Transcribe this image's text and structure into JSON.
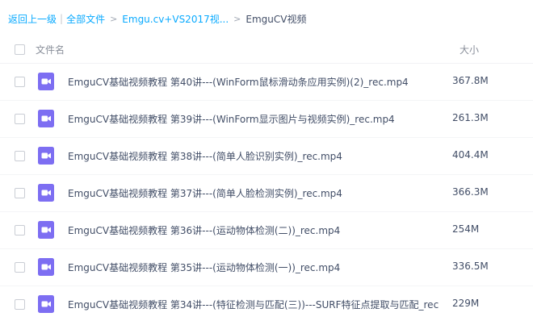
{
  "breadcrumb": {
    "back_label": "返回上一级",
    "sep_bar": "|",
    "all_files_label": "全部文件",
    "chevron": ">",
    "path_item_1": "Emgu.cv+VS2017视...",
    "current": "EmguCV视频"
  },
  "header": {
    "name_label": "文件名",
    "size_label": "大小"
  },
  "file_icon": "video-file-icon",
  "accent_color": "#7d6ef2",
  "files": [
    {
      "name": "EmguCV基础视频教程 第40讲---(WinForm鼠标滑动条应用实例)(2)_rec.mp4",
      "size": "367.8M"
    },
    {
      "name": "EmguCV基础视频教程 第39讲---(WinForm显示图片与视频实例)_rec.mp4",
      "size": "261.3M"
    },
    {
      "name": "EmguCV基础视频教程 第38讲---(简单人脸识别实例)_rec.mp4",
      "size": "404.4M"
    },
    {
      "name": "EmguCV基础视频教程 第37讲---(简单人脸检测实例)_rec.mp4",
      "size": "366.3M"
    },
    {
      "name": "EmguCV基础视频教程 第36讲---(运动物体检测(二))_rec.mp4",
      "size": "254M"
    },
    {
      "name": "EmguCV基础视频教程 第35讲---(运动物体检测(一))_rec.mp4",
      "size": "336.5M"
    },
    {
      "name": "EmguCV基础视频教程 第34讲---(特征检测与匹配(三))---SURF特征点提取与匹配_rec...",
      "size": "229M"
    }
  ]
}
